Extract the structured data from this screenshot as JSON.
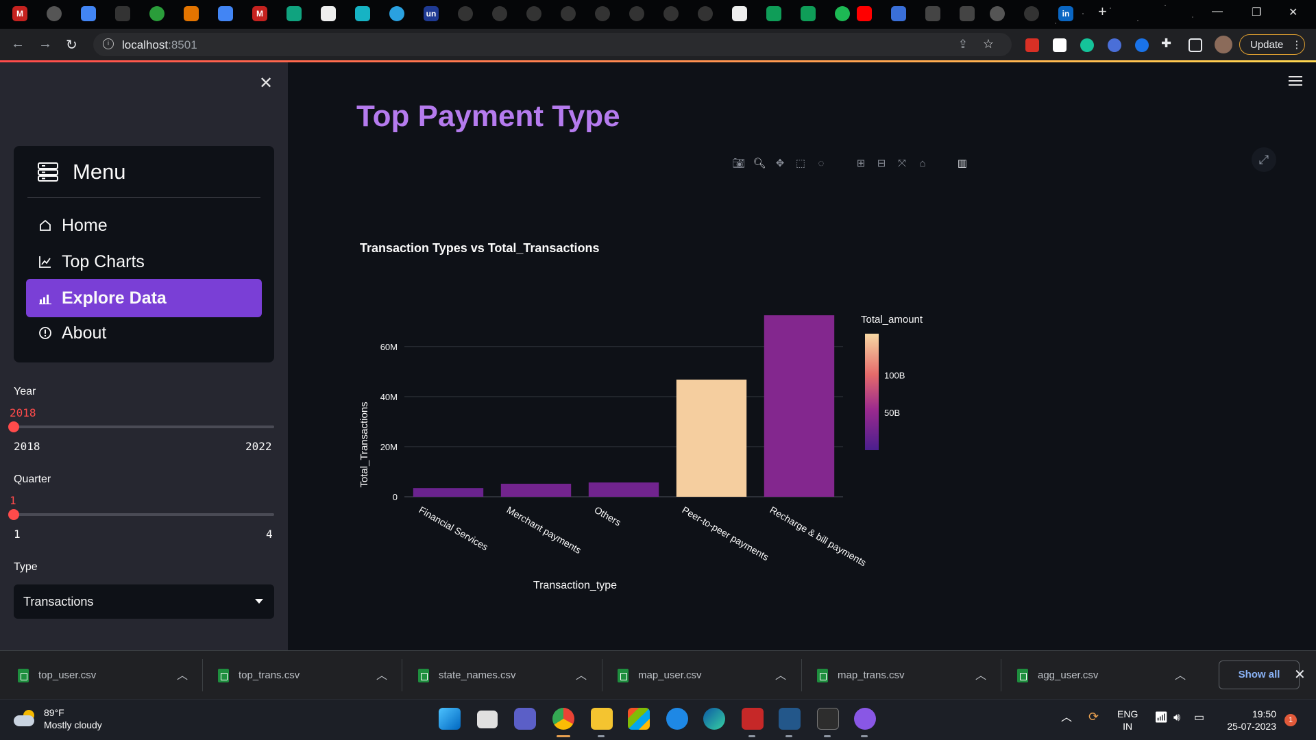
{
  "browser": {
    "url_host": "localhost",
    "url_port": ":8501",
    "update_label": "Update"
  },
  "sidebar": {
    "menu_title": "Menu",
    "items": [
      {
        "label": "Home",
        "icon": "house-icon"
      },
      {
        "label": "Top Charts",
        "icon": "trend-chart-icon"
      },
      {
        "label": "Explore Data",
        "icon": "bar-chart-icon",
        "active": true
      },
      {
        "label": "About",
        "icon": "info-circle-icon"
      }
    ],
    "year": {
      "label": "Year",
      "value": "2018",
      "min": "2018",
      "max": "2022"
    },
    "quarter": {
      "label": "Quarter",
      "value": "1",
      "min": "1",
      "max": "4"
    },
    "type": {
      "label": "Type",
      "value": "Transactions"
    }
  },
  "main": {
    "title": "Top Payment Type"
  },
  "chart_data": {
    "type": "bar",
    "title": "Transaction Types vs Total_Transactions",
    "xlabel": "Transaction_type",
    "ylabel": "Total_Transactions",
    "categories": [
      "Financial Services",
      "Merchant payments",
      "Others",
      "Peer-to-peer payments",
      "Recharge & bill payments"
    ],
    "values": [
      3500000,
      5200000,
      5700000,
      46800000,
      72500000
    ],
    "ylim": [
      0,
      75000000
    ],
    "yticks": [
      0,
      20000000,
      40000000,
      60000000
    ],
    "ytick_labels": [
      "0",
      "20M",
      "40M",
      "60M"
    ],
    "color_values": [
      21000000000,
      27000000000,
      26000000000,
      150000000000,
      38000000000
    ],
    "colorbar": {
      "title": "Total_amount",
      "tick_values": [
        50000000000,
        100000000000
      ],
      "tick_labels": [
        "50B",
        "100B"
      ],
      "range": [
        0,
        155000000000
      ]
    },
    "grid": true,
    "colors": {
      "low": "#5b2a9e",
      "high": "#f0dba4"
    }
  },
  "downloads": {
    "files": [
      "top_user.csv",
      "top_trans.csv",
      "state_names.csv",
      "map_user.csv",
      "map_trans.csv",
      "agg_user.csv"
    ],
    "show_all": "Show all"
  },
  "taskbar": {
    "temperature": "89°F",
    "condition": "Mostly cloudy",
    "lang": "ENG",
    "region": "IN",
    "time": "19:50",
    "date": "25-07-2023",
    "notifications": "1"
  }
}
